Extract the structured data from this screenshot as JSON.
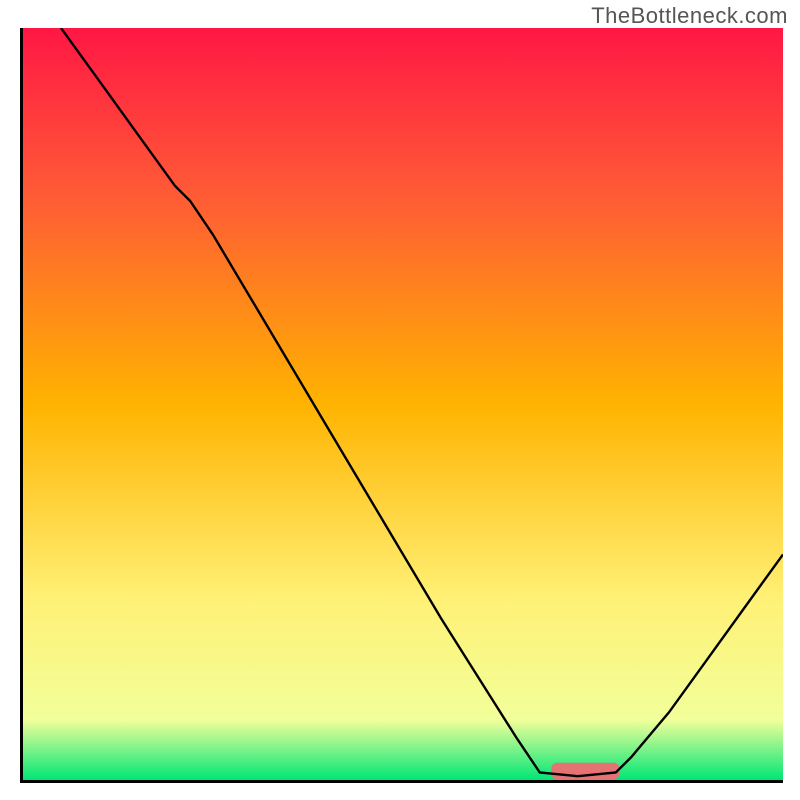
{
  "watermark": "TheBottleneck.com",
  "chart_data": {
    "type": "line",
    "title": "",
    "xlabel": "",
    "ylabel": "",
    "xlim": [
      0,
      100
    ],
    "ylim": [
      0,
      100
    ],
    "gradient_colors": {
      "top": "#ff1744",
      "upper_mid": "#ff5a36",
      "mid": "#ffb300",
      "lower_mid": "#fff176",
      "near_bottom": "#f2ff9a",
      "bottom": "#00e676"
    },
    "curve": {
      "name": "bottleneck-curve",
      "color": "#000000",
      "width": 2,
      "x": [
        5,
        10,
        15,
        20,
        22,
        25,
        30,
        35,
        40,
        45,
        50,
        55,
        60,
        65,
        68,
        73,
        78,
        80,
        85,
        90,
        95,
        100
      ],
      "y": [
        100,
        93,
        86,
        79,
        77,
        72.5,
        64,
        55.5,
        47,
        38.5,
        30,
        21.5,
        13.5,
        5.5,
        1.0,
        0.5,
        1.0,
        3,
        9,
        16,
        23,
        30
      ]
    },
    "marker": {
      "name": "optimal-range",
      "shape": "rounded-rect",
      "color": "#e57373",
      "x_center": 74,
      "y_center": 1.2,
      "width": 9,
      "height": 2.2
    }
  }
}
